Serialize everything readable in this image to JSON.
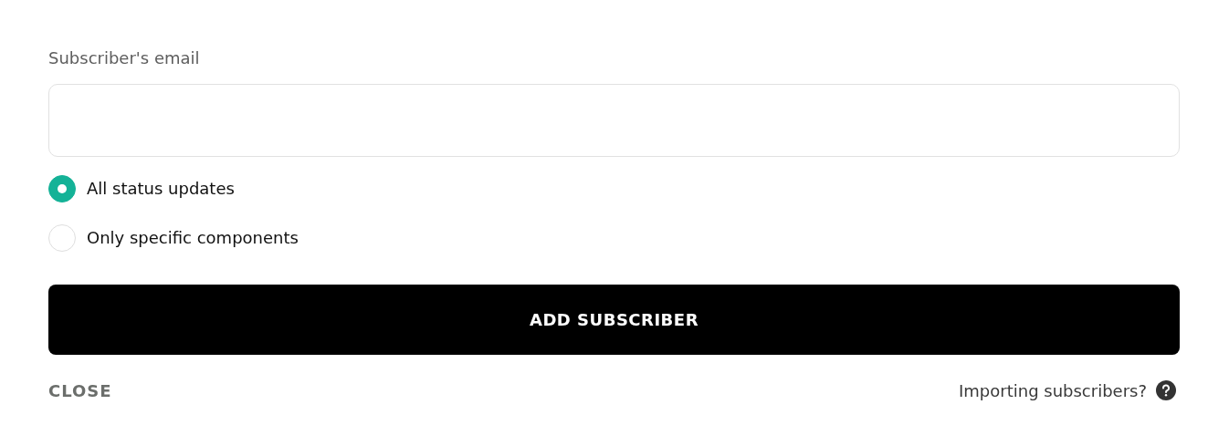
{
  "email_field": {
    "label": "Subscriber's email"
  },
  "options": [
    {
      "label": "All status updates",
      "selected": true
    },
    {
      "label": "Only specific components",
      "selected": false
    }
  ],
  "submit_button": "ADD SUBSCRIBER",
  "close_button": "CLOSE",
  "import_link": "Importing subscribers?"
}
